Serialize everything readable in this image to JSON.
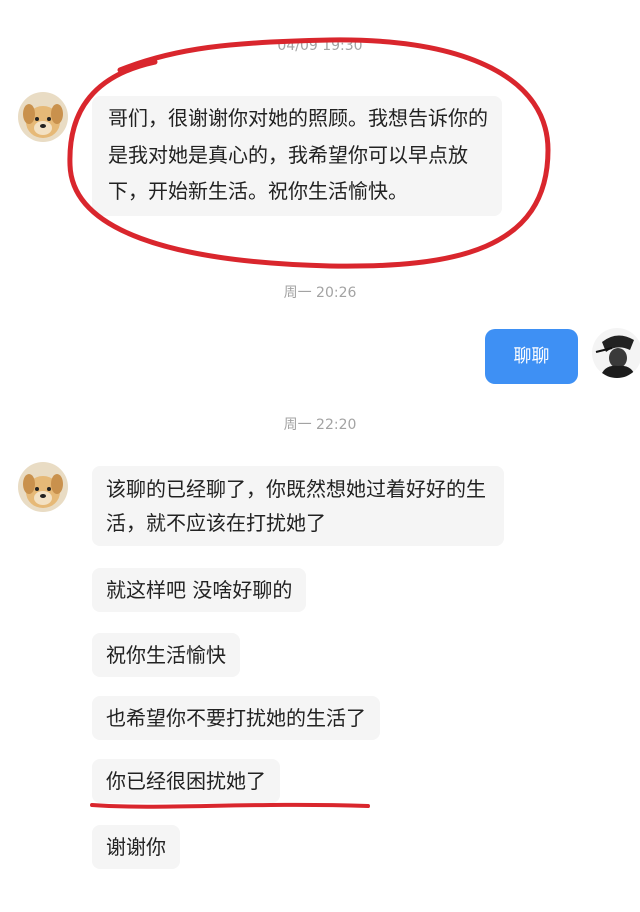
{
  "messages": {
    "first_ts": "04/09 19:30",
    "first": "哥们，很谢谢你对她的照顾。我想告诉你的是我对她是真心的，我希望你可以早点放下，开始新生活。祝你生活愉快。",
    "ts2": "周一 20:26",
    "sent": "聊聊",
    "ts3": "周一 22:20",
    "replies": [
      "该聊的已经聊了，你既然想她过着好好的生活，就不应该在打扰她了",
      "就这样吧 没啥好聊的",
      "祝你生活愉快",
      "也希望你不要打扰她的生活了",
      "你已经很困扰她了",
      "谢谢你"
    ]
  },
  "colors": {
    "sent_bubble": "#3e90f4",
    "received_bubble": "#f5f5f5",
    "annotation": "#d9262d"
  },
  "icons": {
    "contact_avatar": "dog-avatar-icon",
    "self_avatar": "user-avatar-icon"
  }
}
